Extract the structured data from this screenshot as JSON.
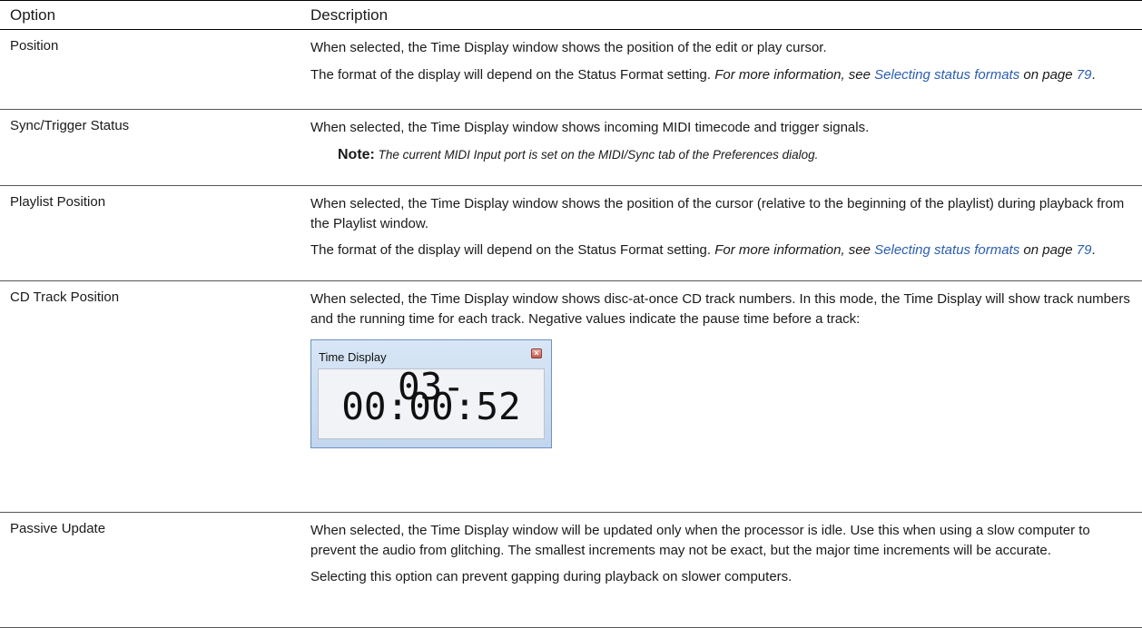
{
  "header": {
    "option": "Option",
    "description": "Description"
  },
  "rows": [
    {
      "option": "Position",
      "p1": "When selected, the Time Display window shows the position of the edit or play cursor.",
      "p2_a": "The format of the display will depend on the Status Format setting. ",
      "p2_b": "For more information, see ",
      "p2_link": "Selecting status formats",
      "p2_c": " on page ",
      "p2_page": "79",
      "p2_d": "."
    },
    {
      "option": "Sync/Trigger Status",
      "p1": "When selected, the Time Display window shows incoming MIDI timecode and trigger signals.",
      "note_label": "Note:",
      "note_text": " The current MIDI Input port is set on the MIDI/Sync tab of the Preferences dialog."
    },
    {
      "option": "Playlist Position",
      "p1": "When selected, the Time Display window shows the position of the cursor (relative to the beginning of the playlist) during playback from the Playlist window.",
      "p2_a": "The format of the display will depend on the Status Format setting. ",
      "p2_b": "For more information, see ",
      "p2_link": "Selecting status formats",
      "p2_c": " on page ",
      "p2_page": "79",
      "p2_d": "."
    },
    {
      "option": "CD Track Position",
      "p1": "When selected, the Time Display window shows disc-at-once CD track numbers. In this mode, the Time Display will show track numbers and the running time for each track. Negative values indicate the pause time before a track:",
      "widget": {
        "title": "Time Display",
        "close": "×",
        "time": "03-00:00:52"
      }
    },
    {
      "option": "Passive Update",
      "p1": "When selected, the Time Display window will be updated only when the processor is idle. Use this when using a slow computer to prevent the audio from glitching. The smallest increments may not be exact, but the major time increments will be accurate.",
      "p2": "Selecting this option can prevent gapping during playback on slower computers."
    }
  ]
}
